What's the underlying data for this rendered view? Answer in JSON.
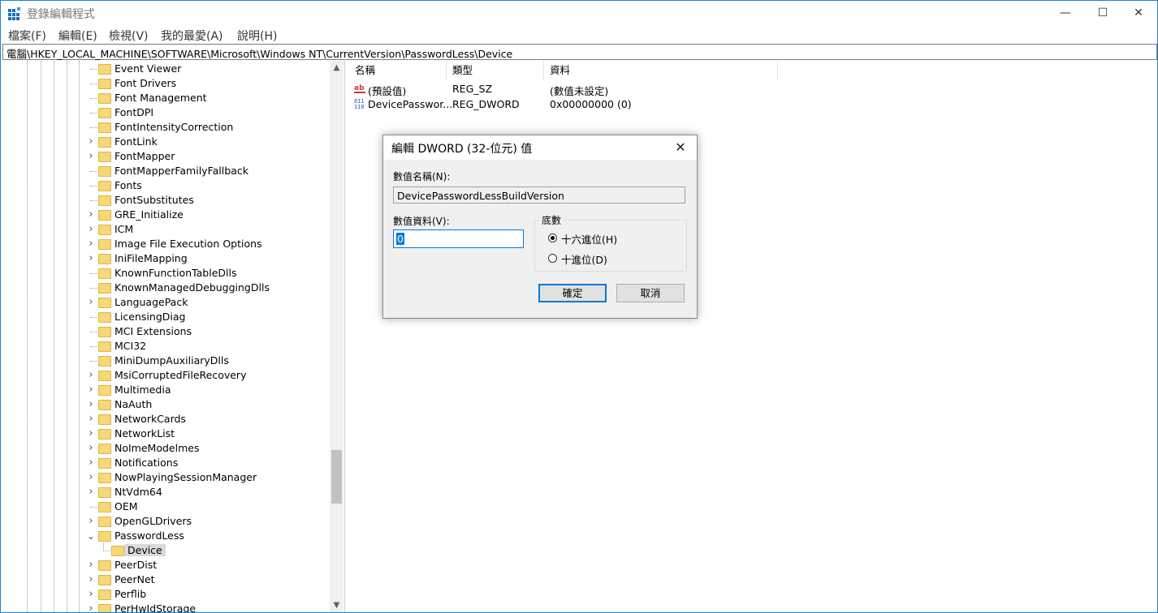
{
  "window": {
    "title": "登錄編輯程式",
    "minimize_glyph": "—",
    "maximize_glyph": "☐",
    "close_glyph": "✕"
  },
  "menu": [
    "檔案(F)",
    "編輯(E)",
    "檢視(V)",
    "我的最愛(A)",
    "說明(H)"
  ],
  "address": "電腦\\HKEY_LOCAL_MACHINE\\SOFTWARE\\Microsoft\\Windows NT\\CurrentVersion\\PasswordLess\\Device",
  "tree": {
    "items": [
      {
        "label": "Event Viewer",
        "expandable": false
      },
      {
        "label": "Font Drivers",
        "expandable": false
      },
      {
        "label": "Font Management",
        "expandable": false
      },
      {
        "label": "FontDPI",
        "expandable": false
      },
      {
        "label": "FontIntensityCorrection",
        "expandable": false
      },
      {
        "label": "FontLink",
        "expandable": true
      },
      {
        "label": "FontMapper",
        "expandable": true
      },
      {
        "label": "FontMapperFamilyFallback",
        "expandable": false
      },
      {
        "label": "Fonts",
        "expandable": false
      },
      {
        "label": "FontSubstitutes",
        "expandable": false
      },
      {
        "label": "GRE_Initialize",
        "expandable": true
      },
      {
        "label": "ICM",
        "expandable": true
      },
      {
        "label": "Image File Execution Options",
        "expandable": true
      },
      {
        "label": "IniFileMapping",
        "expandable": true
      },
      {
        "label": "KnownFunctionTableDlls",
        "expandable": false
      },
      {
        "label": "KnownManagedDebuggingDlls",
        "expandable": false
      },
      {
        "label": "LanguagePack",
        "expandable": true
      },
      {
        "label": "LicensingDiag",
        "expandable": false
      },
      {
        "label": "MCI Extensions",
        "expandable": false
      },
      {
        "label": "MCI32",
        "expandable": false
      },
      {
        "label": "MiniDumpAuxiliaryDlls",
        "expandable": false
      },
      {
        "label": "MsiCorruptedFileRecovery",
        "expandable": true
      },
      {
        "label": "Multimedia",
        "expandable": true
      },
      {
        "label": "NaAuth",
        "expandable": true
      },
      {
        "label": "NetworkCards",
        "expandable": true
      },
      {
        "label": "NetworkList",
        "expandable": true
      },
      {
        "label": "NoImeModelmes",
        "expandable": true
      },
      {
        "label": "Notifications",
        "expandable": true
      },
      {
        "label": "NowPlayingSessionManager",
        "expandable": true
      },
      {
        "label": "NtVdm64",
        "expandable": true
      },
      {
        "label": "OEM",
        "expandable": false
      },
      {
        "label": "OpenGLDrivers",
        "expandable": true
      },
      {
        "label": "PasswordLess",
        "expandable": true,
        "expanded": true
      },
      {
        "label": "Device",
        "expandable": false,
        "child": true,
        "selected": true
      },
      {
        "label": "PeerDist",
        "expandable": true
      },
      {
        "label": "PeerNet",
        "expandable": true
      },
      {
        "label": "Perflib",
        "expandable": true
      },
      {
        "label": "PerHwIdStorage",
        "expandable": true
      }
    ]
  },
  "list": {
    "headers": [
      "名稱",
      "類型",
      "資料"
    ],
    "rows": [
      {
        "icon": "string-value-icon",
        "name": "(預設值)",
        "type": "REG_SZ",
        "data": "(數值未設定)"
      },
      {
        "icon": "dword-value-icon",
        "name": "DevicePasswor...",
        "type": "REG_DWORD",
        "data": "0x00000000 (0)"
      }
    ]
  },
  "dialog": {
    "title": "編輯 DWORD (32-位元) 值",
    "name_label": "數值名稱(N):",
    "name_value": "DevicePasswordLessBuildVersion",
    "data_label": "數值資料(V):",
    "data_value": "0",
    "base_label": "底數",
    "hex_label": "十六進位(H)",
    "dec_label": "十進位(D)",
    "base_selected": "hex",
    "ok_label": "確定",
    "cancel_label": "取消",
    "close_glyph": "✕"
  },
  "colors": {
    "accent": "#0078d7",
    "folder": "#f8d775",
    "selection": "#d9d9d9"
  }
}
